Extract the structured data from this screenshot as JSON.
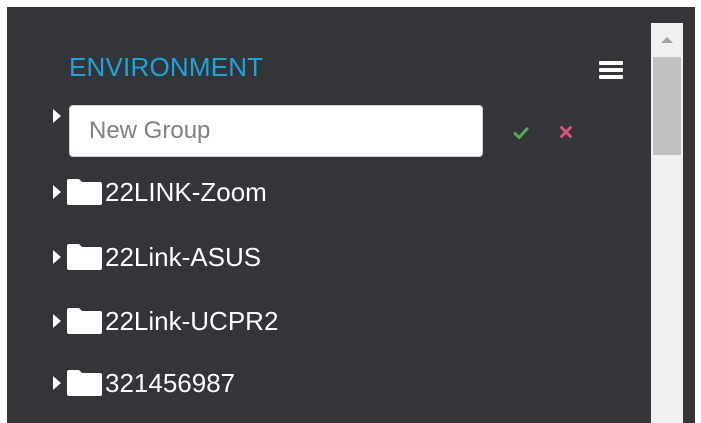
{
  "panel": {
    "title": "ENVIRONMENT",
    "menu_icon": "hamburger-menu-icon"
  },
  "new_group": {
    "placeholder": "New Group",
    "value": "",
    "confirm_icon": "checkmark-icon",
    "cancel_icon": "close-x-icon",
    "confirm_color": "#4caf50",
    "cancel_color": "#e0507a"
  },
  "groups": [
    {
      "label": "22LINK-Zoom",
      "icon": "folder-icon"
    },
    {
      "label": "22Link-ASUS",
      "icon": "folder-icon"
    },
    {
      "label": "22Link-UCPR2",
      "icon": "folder-icon"
    },
    {
      "label": "321456987",
      "icon": "folder-icon"
    }
  ],
  "colors": {
    "background": "#333538",
    "title": "#1aa6dd",
    "text": "#ffffff",
    "scrollbar_track": "#f1f1f1",
    "scrollbar_thumb": "#c1c1c1"
  }
}
